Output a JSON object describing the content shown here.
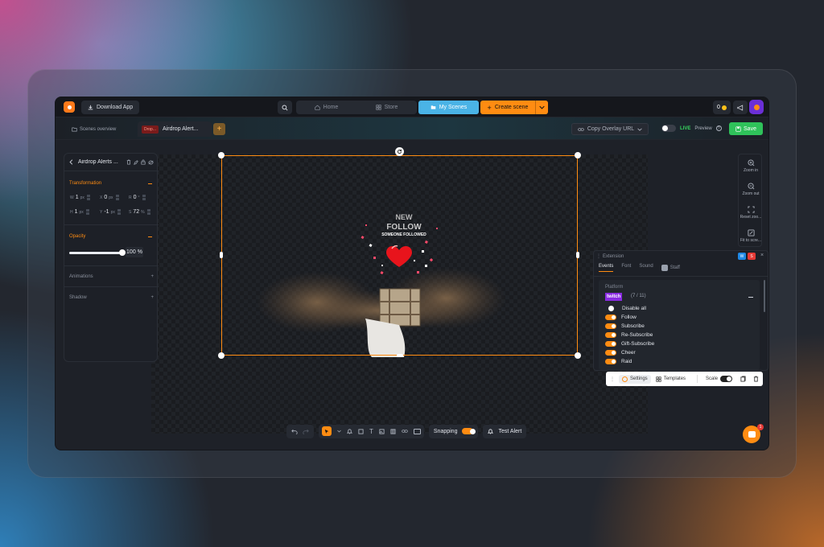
{
  "colors": {
    "accent": "#ff8c12",
    "active_scene": "#4ab3e6",
    "save": "#2fc25a",
    "live": "#37d65f",
    "twitch": "#8a2be2"
  },
  "topbar": {
    "download_app": "Download App",
    "nav": [
      {
        "label": "Home",
        "icon": "home-icon"
      },
      {
        "label": "Store",
        "icon": "store-icon"
      }
    ],
    "my_scenes": "My Scenes",
    "create_scene": "Create scene",
    "coins": "0"
  },
  "tabs": {
    "overview": "Scenes overview",
    "active_tag": "Drop...",
    "active_label": "Airdrop Alert..."
  },
  "toolbar": {
    "copy_url": "Copy Overlay URL",
    "live_label": "LIVE",
    "preview_label": "Preview",
    "save": "Save"
  },
  "left_panel": {
    "title": "Airdrop Alerts ...",
    "transformation": "Transformation",
    "fields": {
      "w": {
        "label": "W",
        "value": "1",
        "unit": "px"
      },
      "x": {
        "label": "X",
        "value": "0",
        "unit": "px"
      },
      "r": {
        "label": "R",
        "value": "0",
        "unit": "°"
      },
      "h": {
        "label": "H",
        "value": "1",
        "unit": "px"
      },
      "y": {
        "label": "Y",
        "value": "-1",
        "unit": "px"
      },
      "s": {
        "label": "S",
        "value": "72",
        "unit": "%"
      }
    },
    "opacity": "Opacity",
    "opacity_value": "100",
    "opacity_unit": "%",
    "opacity_level": 1.0,
    "animations": "Animations",
    "shadow": "Shadow"
  },
  "zoom": {
    "zoom_in": "Zoom in",
    "zoom_out": "Zoom out",
    "reset": "Reset zoo...",
    "fit": "Fit to scre..."
  },
  "alert_preview": {
    "line1": "NEW",
    "line2": "FOLLOW",
    "line3": "SOMEONE FOLLOWED"
  },
  "extension": {
    "title": "Extension",
    "tabs": [
      "Events",
      "Font",
      "Sound",
      "Staff"
    ],
    "platform_label": "Platform",
    "platform_name": "twitch",
    "count": "(7 / 11)",
    "disable_all": "Disable all",
    "events": [
      "Follow",
      "Subscribe",
      "Re-Subscribe",
      "Gift-Subscribe",
      "Cheer",
      "Raid"
    ]
  },
  "settings_bar": {
    "settings": "Settings",
    "templates": "Templates",
    "scale": "Scale"
  },
  "bottom": {
    "snapping": "Snapping",
    "test_alert": "Test Alert"
  },
  "chat_badge": "1"
}
